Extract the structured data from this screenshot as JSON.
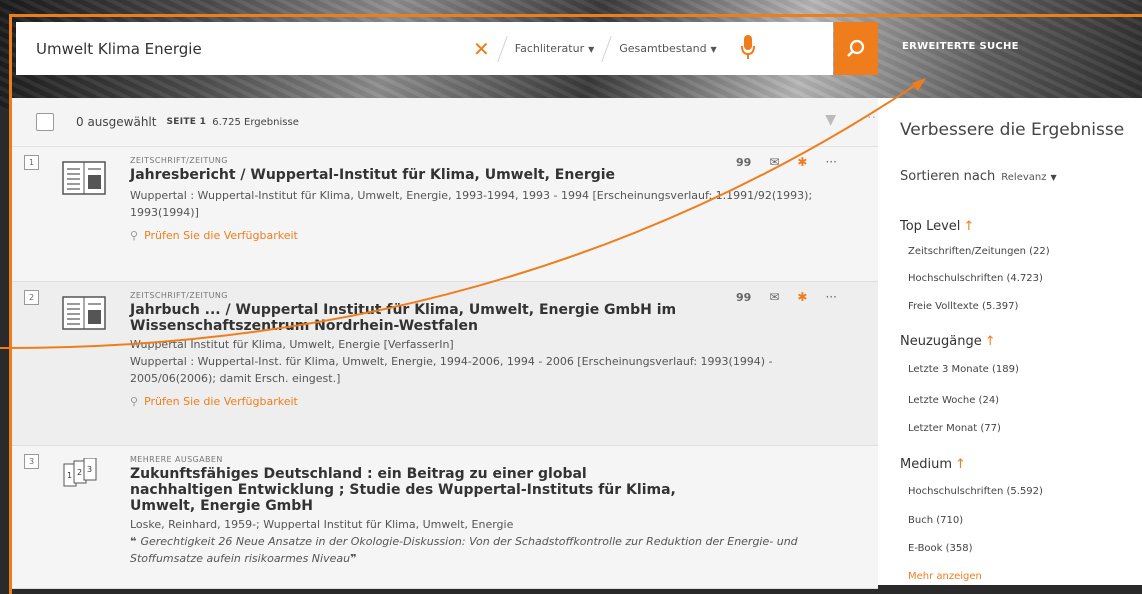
{
  "search": {
    "query": "Umwelt Klima Energie",
    "clear": "✕",
    "scope1": "Fachliteratur",
    "scope2": "Gesamtbestand",
    "advanced": "ERWEITERTE SUCHE"
  },
  "toolbar": {
    "selected": "0 ausgewählt",
    "page": "SEITE 1",
    "count": "6.725 Ergebnisse"
  },
  "results": [
    {
      "num": "1",
      "type": "ZEITSCHRIFT/ZEITUNG",
      "title": "Jahresbericht / Wuppertal-Institut für Klima, Umwelt, Energie",
      "pub": "Wuppertal : Wuppertal-Institut für Klima, Umwelt, Energie, 1993-1994, 1993 - 1994 [Erscheinungsverlauf: 1.1991/92(1993); 1993(1994)]",
      "avail": "Prüfen Sie die Verfügbarkeit"
    },
    {
      "num": "2",
      "type": "ZEITSCHRIFT/ZEITUNG",
      "title": "Jahrbuch ... / Wuppertal Institut für Klima, Umwelt, Energie GmbH im Wissenschaftszentrum Nordrhein-Westfalen",
      "author": "Wuppertal Institut für Klima, Umwelt, Energie [VerfasserIn]",
      "pub": "Wuppertal : Wuppertal-Inst. für Klima, Umwelt, Energie, 1994-2006, 1994 - 2006 [Erscheinungsverlauf: 1993(1994) - 2005/06(2006); damit Ersch. eingest.]",
      "avail": "Prüfen Sie die Verfügbarkeit"
    },
    {
      "num": "3",
      "type": "MEHRERE AUSGABEN",
      "title": "Zukunftsfähiges Deutschland : ein Beitrag zu einer global nachhaltigen Entwicklung ; Studie des Wuppertal-Instituts für Klima, Umwelt, Energie GmbH",
      "author": "Loske, Reinhard, 1959-; Wuppertal Institut für Klima, Umwelt, Energie",
      "quote": "Gerechtigkeit 26 Neue Ansatze in der Okologie-Diskussion: Von der Schadstoffkontrolle zur Reduktion der Energie- und Stoffumsatze aufein risikoarmes Niveau"
    }
  ],
  "actions": {
    "cite": "99",
    "mail": "✉",
    "pin": "📌",
    "more": "···"
  },
  "right": {
    "title": "Verbessere die Ergebnisse",
    "sort_label": "Sortieren nach",
    "sort_value": "Relevanz",
    "facets": [
      {
        "heading": "Top Level",
        "items": [
          "Zeitschriften/Zeitungen (22)",
          "Hochschulschriften (4.723)",
          "Freie Volltexte (5.397)"
        ]
      },
      {
        "heading": "Neuzugänge",
        "items": [
          "Letzte 3 Monate (189)",
          "Letzte Woche (24)",
          "Letzter Monat (77)"
        ]
      },
      {
        "heading": "Medium",
        "items": [
          "Hochschulschriften (5.592)",
          "Buch (710)",
          "E-Book (358)"
        ]
      }
    ],
    "more": "Mehr anzeigen"
  },
  "colors": {
    "accent": "#f07d1c"
  }
}
